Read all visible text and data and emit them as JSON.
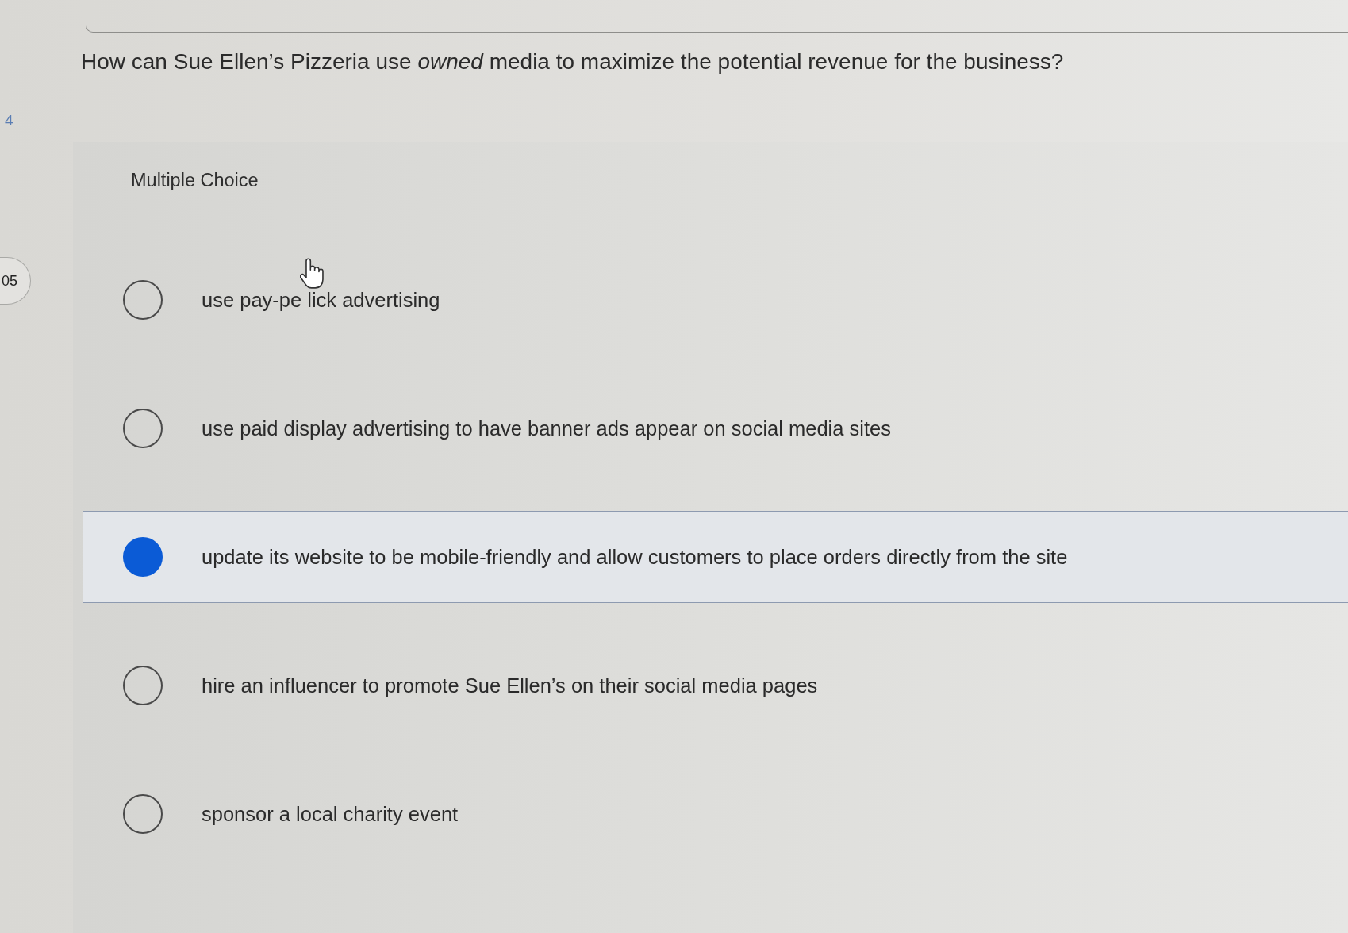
{
  "sidebar": {
    "items": [
      {
        "kind": "plain",
        "label": "4"
      },
      {
        "kind": "pill",
        "label": "05"
      }
    ]
  },
  "question": {
    "text": "How can Sue Ellen’s Pizzeria use *owned* media to maximize the potential revenue for the business?"
  },
  "answer_area": {
    "label": "Multiple Choice",
    "options": [
      {
        "label": "use pay-pe lick advertising",
        "selected": false,
        "pointer": true
      },
      {
        "label": "use paid display advertising to have banner ads appear on social media sites",
        "selected": false,
        "pointer": false
      },
      {
        "label": "update its website to be mobile-friendly and allow customers to place orders directly from the site",
        "selected": true,
        "pointer": false
      },
      {
        "label": "hire an influencer to promote Sue Ellen’s on their social media pages",
        "selected": false,
        "pointer": false
      },
      {
        "label": "sponsor a local charity event",
        "selected": false,
        "pointer": false
      }
    ]
  }
}
